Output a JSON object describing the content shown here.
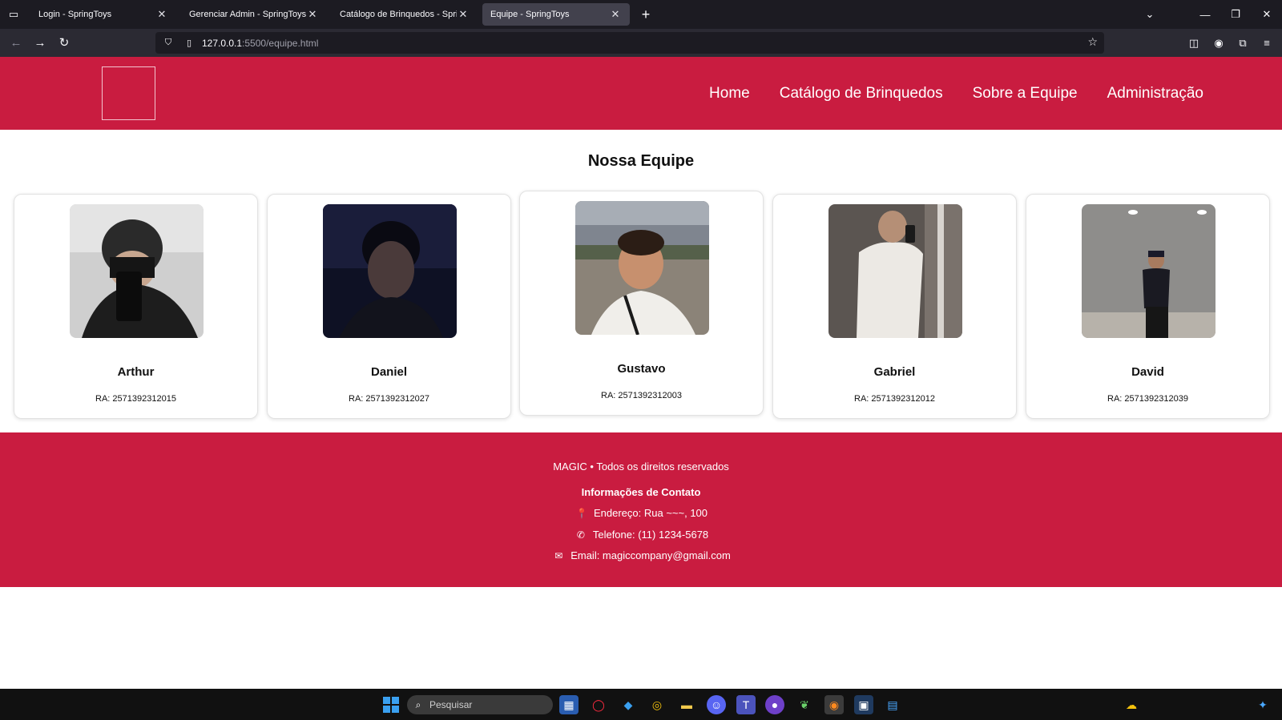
{
  "browser": {
    "tabs": [
      {
        "title": "Login - SpringToys",
        "active": false
      },
      {
        "title": "Gerenciar Admin - SpringToys",
        "active": false
      },
      {
        "title": "Catálogo de Brinquedos - SpringToys",
        "active": false
      },
      {
        "title": "Equipe - SpringToys",
        "active": true
      }
    ],
    "url_host": "127.0.0.1",
    "url_path": ":5500/equipe.html"
  },
  "site": {
    "nav": [
      "Home",
      "Catálogo de Brinquedos",
      "Sobre a Equipe",
      "Administração"
    ],
    "brand_color": "#c91c40"
  },
  "main": {
    "title": "Nossa Equipe",
    "members": [
      {
        "name": "Arthur",
        "ra": "RA: 2571392312015"
      },
      {
        "name": "Daniel",
        "ra": "RA: 2571392312027"
      },
      {
        "name": "Gustavo",
        "ra": "RA: 2571392312003"
      },
      {
        "name": "Gabriel",
        "ra": "RA: 2571392312012"
      },
      {
        "name": "David",
        "ra": "RA: 2571392312039"
      }
    ]
  },
  "footer": {
    "copyright": "MAGIC • Todos os direitos reservados",
    "contact_heading": "Informações de Contato",
    "address": "Endereço: Rua ~~~, 100",
    "phone": "Telefone: (11) 1234-5678",
    "email": "Email: magiccompany@gmail.com"
  },
  "taskbar": {
    "search_placeholder": "Pesquisar"
  }
}
